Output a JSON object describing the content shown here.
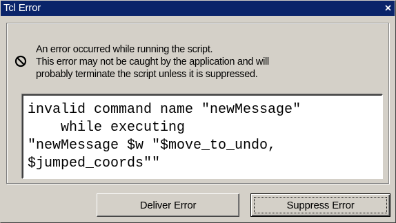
{
  "window": {
    "title": "Tcl Error",
    "close_icon": "close-icon"
  },
  "message": {
    "icon": "stop-icon",
    "lines": [
      "An error occurred while  running the script.",
      "This error may not be caught by the application  and will",
      "probably terminate the script unless it is suppressed."
    ]
  },
  "details": {
    "lines": [
      "invalid command name \"newMessage\"",
      "    while executing",
      "\"newMessage $w \"$move_to_undo,",
      "$jumped_coords\"\""
    ]
  },
  "buttons": {
    "deliver_label": "Deliver Error",
    "suppress_label": "Suppress Error"
  },
  "colors": {
    "titlebar": "#0a246a",
    "face": "#d4d0c8"
  }
}
